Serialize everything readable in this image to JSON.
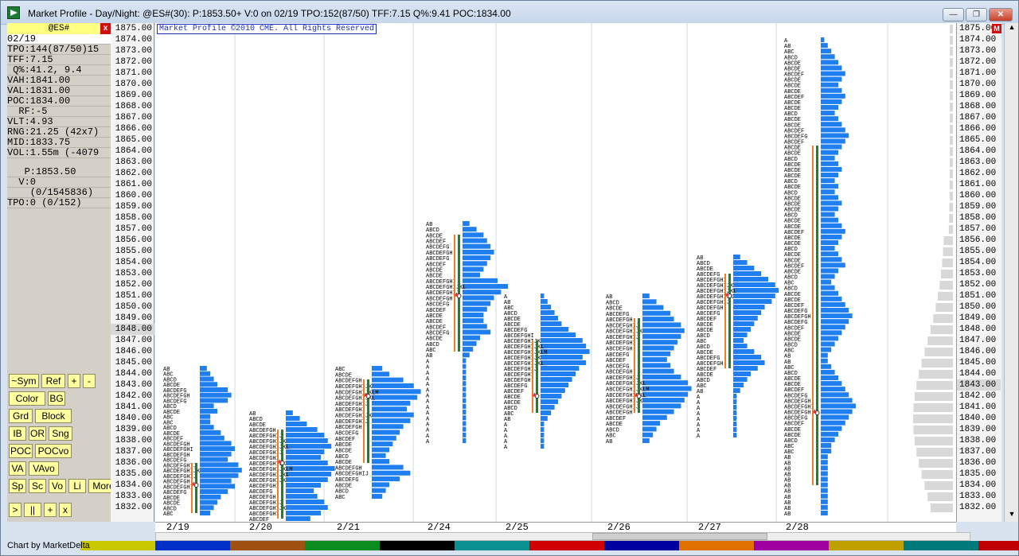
{
  "window": {
    "title": "Market Profile  - Day/Night: @ES#(30): P:1853.50+ V:0 on 02/19 TPO:152(87/50) TFF:7.15 Q%:9.41 POC:1834.00"
  },
  "panel": {
    "symbol": "@ES#",
    "close_symbol": "x",
    "m_label": "M",
    "rows": [
      "02/19",
      "TPO:144(87/50)15",
      "TFF:7.15",
      " Q%:41.2, 9.4",
      "VAH:1841.00",
      "VAL:1831.00",
      "POC:1834.00",
      "  RF:-5",
      "VLT:4.93",
      "RNG:21.25 (42x7)",
      "MID:1833.75",
      "VOL:1.55m (-4079"
    ],
    "quote_rows": [
      "   P:1853.50",
      "  V:0",
      "    (0/1545836)",
      "TPO:0 (0/152)"
    ],
    "buttons": [
      [
        "~Sym",
        "Ref",
        "+",
        "-"
      ],
      [
        "Color",
        "BG"
      ],
      [
        "Grd",
        "Block"
      ],
      [
        "IB",
        "OR",
        "Sng"
      ],
      [
        "POC",
        "POCvo"
      ],
      [
        "VA",
        "VAvo"
      ],
      [
        "Sp",
        "Sc",
        "Vo",
        "Li",
        "More"
      ],
      [
        ">",
        "||",
        "+",
        "x"
      ]
    ]
  },
  "chart": {
    "copyright": "Market Profile ©2010 CME. All Rights Reserved",
    "price_labels": [
      "1875.00",
      "1874.00",
      "1873.00",
      "1872.00",
      "1871.00",
      "1870.00",
      "1869.00",
      "1868.00",
      "1867.00",
      "1866.00",
      "1865.00",
      "1864.00",
      "1863.00",
      "1862.00",
      "1861.00",
      "1860.00",
      "1859.00",
      "1858.00",
      "1857.00",
      "1856.00",
      "1855.00",
      "1854.00",
      "1853.00",
      "1852.00",
      "1851.00",
      "1850.00",
      "1849.00",
      "1848.00",
      "1847.00",
      "1846.00",
      "1845.00",
      "1844.00",
      "1843.00",
      "1842.00",
      "1841.00",
      "1840.00",
      "1839.00",
      "1838.00",
      "1837.00",
      "1836.00",
      "1835.00",
      "1834.00",
      "1833.00",
      "1832.00"
    ],
    "right_m": "M",
    "dates": [
      "2/19",
      "2/20",
      "2/21",
      "2/24",
      "2/25",
      "2/26",
      "2/27",
      "2/28"
    ],
    "profiles": [
      {
        "date": "2/19",
        "high": 1844.5,
        "low": 1831.5,
        "poc": 1834,
        "vah": 1836,
        "val": 1831.5,
        "bars": [
          2,
          3,
          4,
          5,
          8,
          9,
          8,
          4,
          5,
          3,
          3,
          4,
          6,
          7,
          9,
          10,
          9,
          8,
          11,
          12,
          11,
          9,
          10,
          8,
          6,
          5,
          4,
          3
        ]
      },
      {
        "date": "2/20",
        "high": 1840.5,
        "low": 1831,
        "poc": 1836,
        "vah": 1839,
        "val": 1831,
        "bars": [
          2,
          4,
          6,
          9,
          11,
          12,
          13,
          11,
          10,
          12,
          14,
          13,
          12,
          10,
          8,
          9,
          11,
          12,
          10,
          7
        ]
      },
      {
        "date": "2/21",
        "high": 1844.5,
        "low": 1833,
        "poc": 1842,
        "vah": 1843.5,
        "val": 1836,
        "bars": [
          3,
          5,
          9,
          12,
          14,
          13,
          11,
          10,
          12,
          11,
          9,
          8,
          7,
          6,
          5,
          4,
          5,
          9,
          11,
          8,
          5,
          4,
          3
        ]
      },
      {
        "date": "2/24",
        "high": 1857.5,
        "low": 1838,
        "poc": 1851,
        "vah": 1856.5,
        "val": 1846,
        "bars": [
          2,
          4,
          6,
          7,
          8,
          9,
          8,
          7,
          6,
          5,
          10,
          13,
          11,
          9,
          8,
          7,
          6,
          6,
          7,
          8,
          5,
          4,
          3,
          2,
          1,
          1,
          1,
          1,
          1,
          1,
          1,
          1,
          1,
          1,
          1,
          1,
          1,
          1,
          1
        ]
      },
      {
        "date": "2/25",
        "high": 1851,
        "low": 1837.5,
        "poc": 1842,
        "vah": 1847,
        "val": 1840.5,
        "bars": [
          1,
          2,
          3,
          4,
          5,
          6,
          8,
          10,
          12,
          13,
          14,
          12,
          13,
          11,
          10,
          9,
          8,
          7,
          6,
          5,
          4,
          3,
          2,
          1,
          1,
          1,
          1,
          1
        ]
      },
      {
        "date": "2/26",
        "high": 1851,
        "low": 1838,
        "poc": 1842,
        "vah": 1849,
        "val": 1840.5,
        "bars": [
          2,
          4,
          6,
          8,
          9,
          11,
          12,
          11,
          10,
          9,
          8,
          7,
          8,
          9,
          11,
          13,
          14,
          13,
          12,
          11,
          9,
          7,
          5,
          4,
          3,
          2
        ]
      },
      {
        "date": "2/27",
        "high": 1854.5,
        "low": 1838.5,
        "poc": 1851,
        "vah": 1853,
        "val": 1844.5,
        "bars": [
          2,
          4,
          6,
          8,
          10,
          12,
          13,
          12,
          11,
          9,
          8,
          7,
          6,
          5,
          4,
          3,
          4,
          6,
          8,
          9,
          7,
          5,
          4,
          3,
          2,
          1,
          1,
          1,
          1,
          1,
          1,
          1,
          1
        ]
      },
      {
        "date": "2/28",
        "high": 1874,
        "low": 1831.5,
        "poc": 1840.5,
        "vah": 1864.5,
        "val": 1834,
        "bars": [
          1,
          2,
          3,
          4,
          5,
          6,
          7,
          6,
          5,
          6,
          7,
          6,
          5,
          4,
          5,
          6,
          7,
          8,
          7,
          6,
          5,
          4,
          5,
          6,
          5,
          4,
          5,
          4,
          5,
          6,
          5,
          4,
          5,
          6,
          7,
          6,
          5,
          4,
          5,
          6,
          7,
          5,
          4,
          3,
          4,
          5,
          6,
          7,
          8,
          9,
          8,
          7,
          6,
          5,
          4,
          3,
          2,
          2,
          3,
          4,
          5,
          6,
          7,
          8,
          9,
          10,
          9,
          8,
          7,
          6,
          5,
          4,
          3,
          3,
          2,
          2,
          2,
          2,
          2,
          2,
          2,
          2,
          2,
          2,
          2
        ]
      }
    ]
  },
  "footer": {
    "text": "Chart by MarketDelta"
  },
  "colors": {
    "bar": "#1f7ff0",
    "va_green": "#1f7f2a",
    "va_orange": "#f07d28",
    "poc_red": "#e02020"
  }
}
